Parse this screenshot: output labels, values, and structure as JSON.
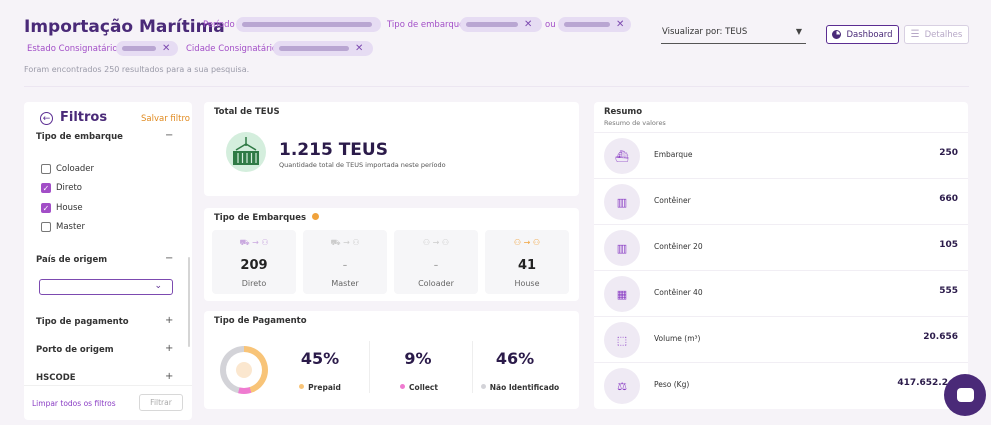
{
  "header": {
    "title": "Importação Marítima",
    "periodo_label": "Período",
    "tipo_embarque_label": "Tipo de embarque",
    "ou_label": "ou",
    "estado_label": "Estado Consignatário",
    "cidade_label": "Cidade Consignatário",
    "result_text": "Foram encontrados 250 resultados para a sua pesquisa.",
    "visualizar_value": "Visualizar por: TEUS",
    "dashboard_button": "Dashboard",
    "detalhes_button": "Detalhes"
  },
  "sidebar": {
    "title": "Filtros",
    "save_filter": "Salvar filtro",
    "tipo_embarque": "Tipo de embarque",
    "options": [
      {
        "label": "Coloader",
        "checked": false
      },
      {
        "label": "Direto",
        "checked": true
      },
      {
        "label": "House",
        "checked": true
      },
      {
        "label": "Master",
        "checked": false
      }
    ],
    "pais_origem": "País de origem",
    "tipo_pagamento": "Tipo de pagamento",
    "porto_origem": "Porto de origem",
    "hscode": "HSCODE",
    "clear_all": "Limpar todos os filtros",
    "filter_button": "Filtrar",
    "minus": "−",
    "plus": "+"
  },
  "teus": {
    "title": "Total de TEUS",
    "value": "1.215 TEUS",
    "desc": "Quantidade total de TEUS importada neste período"
  },
  "embarques": {
    "title": "Tipo de Embarques",
    "items": [
      {
        "value": "209",
        "label": "Direto"
      },
      {
        "value": "-",
        "label": "Master"
      },
      {
        "value": "-",
        "label": "Coloader"
      },
      {
        "value": "41",
        "label": "House"
      }
    ]
  },
  "pagamento": {
    "title": "Tipo de Pagamento",
    "items": [
      {
        "pct": "45%",
        "label": "Prepaid",
        "color": "#f8c478"
      },
      {
        "pct": "9%",
        "label": "Collect",
        "color": "#ef7bd0"
      },
      {
        "pct": "46%",
        "label": "Não Identificado",
        "color": "#d3d3d8"
      }
    ]
  },
  "resumo": {
    "title": "Resumo",
    "subtitle": "Resumo de valores",
    "rows": [
      {
        "label": "Embarque",
        "value": "250"
      },
      {
        "label": "Contêiner",
        "value": "660"
      },
      {
        "label": "Contêiner 20",
        "value": "105"
      },
      {
        "label": "Contêiner 40",
        "value": "555"
      },
      {
        "label": "Volume (m³)",
        "value": "20.656"
      },
      {
        "label": "Peso (Kg)",
        "value": "417.652.2"
      }
    ]
  }
}
